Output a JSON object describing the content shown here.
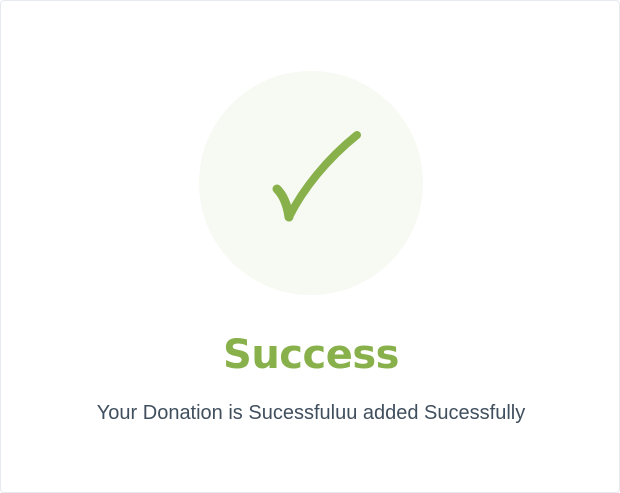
{
  "status": {
    "title": "Success",
    "message": "Your Donation is Sucessfuluu added Sucessfully",
    "icon": "checkmark-icon",
    "colors": {
      "accent": "#88b04b",
      "circle_background": "#f7f9f3",
      "message_text": "#404f5e"
    }
  }
}
